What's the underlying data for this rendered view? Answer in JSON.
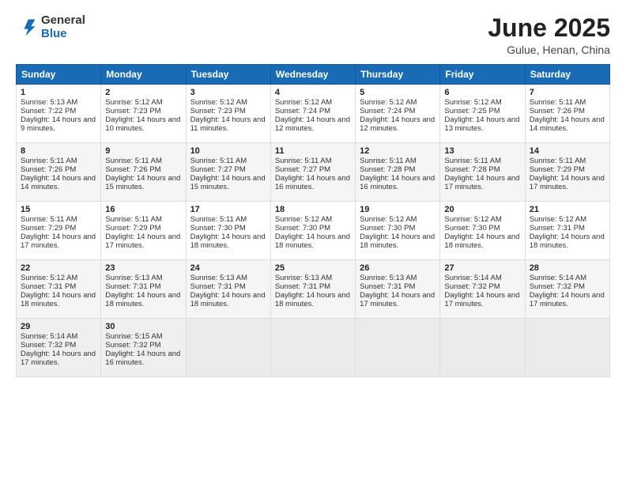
{
  "header": {
    "logo_line1": "General",
    "logo_line2": "Blue",
    "title": "June 2025",
    "subtitle": "Gulue, Henan, China"
  },
  "days_of_week": [
    "Sunday",
    "Monday",
    "Tuesday",
    "Wednesday",
    "Thursday",
    "Friday",
    "Saturday"
  ],
  "weeks": [
    [
      {
        "day": "1",
        "rise": "Sunrise: 5:13 AM",
        "set": "Sunset: 7:22 PM",
        "daylight": "Daylight: 14 hours and 9 minutes."
      },
      {
        "day": "2",
        "rise": "Sunrise: 5:12 AM",
        "set": "Sunset: 7:23 PM",
        "daylight": "Daylight: 14 hours and 10 minutes."
      },
      {
        "day": "3",
        "rise": "Sunrise: 5:12 AM",
        "set": "Sunset: 7:23 PM",
        "daylight": "Daylight: 14 hours and 11 minutes."
      },
      {
        "day": "4",
        "rise": "Sunrise: 5:12 AM",
        "set": "Sunset: 7:24 PM",
        "daylight": "Daylight: 14 hours and 12 minutes."
      },
      {
        "day": "5",
        "rise": "Sunrise: 5:12 AM",
        "set": "Sunset: 7:24 PM",
        "daylight": "Daylight: 14 hours and 12 minutes."
      },
      {
        "day": "6",
        "rise": "Sunrise: 5:12 AM",
        "set": "Sunset: 7:25 PM",
        "daylight": "Daylight: 14 hours and 13 minutes."
      },
      {
        "day": "7",
        "rise": "Sunrise: 5:11 AM",
        "set": "Sunset: 7:26 PM",
        "daylight": "Daylight: 14 hours and 14 minutes."
      }
    ],
    [
      {
        "day": "8",
        "rise": "Sunrise: 5:11 AM",
        "set": "Sunset: 7:26 PM",
        "daylight": "Daylight: 14 hours and 14 minutes."
      },
      {
        "day": "9",
        "rise": "Sunrise: 5:11 AM",
        "set": "Sunset: 7:26 PM",
        "daylight": "Daylight: 14 hours and 15 minutes."
      },
      {
        "day": "10",
        "rise": "Sunrise: 5:11 AM",
        "set": "Sunset: 7:27 PM",
        "daylight": "Daylight: 14 hours and 15 minutes."
      },
      {
        "day": "11",
        "rise": "Sunrise: 5:11 AM",
        "set": "Sunset: 7:27 PM",
        "daylight": "Daylight: 14 hours and 16 minutes."
      },
      {
        "day": "12",
        "rise": "Sunrise: 5:11 AM",
        "set": "Sunset: 7:28 PM",
        "daylight": "Daylight: 14 hours and 16 minutes."
      },
      {
        "day": "13",
        "rise": "Sunrise: 5:11 AM",
        "set": "Sunset: 7:28 PM",
        "daylight": "Daylight: 14 hours and 17 minutes."
      },
      {
        "day": "14",
        "rise": "Sunrise: 5:11 AM",
        "set": "Sunset: 7:29 PM",
        "daylight": "Daylight: 14 hours and 17 minutes."
      }
    ],
    [
      {
        "day": "15",
        "rise": "Sunrise: 5:11 AM",
        "set": "Sunset: 7:29 PM",
        "daylight": "Daylight: 14 hours and 17 minutes."
      },
      {
        "day": "16",
        "rise": "Sunrise: 5:11 AM",
        "set": "Sunset: 7:29 PM",
        "daylight": "Daylight: 14 hours and 17 minutes."
      },
      {
        "day": "17",
        "rise": "Sunrise: 5:11 AM",
        "set": "Sunset: 7:30 PM",
        "daylight": "Daylight: 14 hours and 18 minutes."
      },
      {
        "day": "18",
        "rise": "Sunrise: 5:12 AM",
        "set": "Sunset: 7:30 PM",
        "daylight": "Daylight: 14 hours and 18 minutes."
      },
      {
        "day": "19",
        "rise": "Sunrise: 5:12 AM",
        "set": "Sunset: 7:30 PM",
        "daylight": "Daylight: 14 hours and 18 minutes."
      },
      {
        "day": "20",
        "rise": "Sunrise: 5:12 AM",
        "set": "Sunset: 7:30 PM",
        "daylight": "Daylight: 14 hours and 18 minutes."
      },
      {
        "day": "21",
        "rise": "Sunrise: 5:12 AM",
        "set": "Sunset: 7:31 PM",
        "daylight": "Daylight: 14 hours and 18 minutes."
      }
    ],
    [
      {
        "day": "22",
        "rise": "Sunrise: 5:12 AM",
        "set": "Sunset: 7:31 PM",
        "daylight": "Daylight: 14 hours and 18 minutes."
      },
      {
        "day": "23",
        "rise": "Sunrise: 5:13 AM",
        "set": "Sunset: 7:31 PM",
        "daylight": "Daylight: 14 hours and 18 minutes."
      },
      {
        "day": "24",
        "rise": "Sunrise: 5:13 AM",
        "set": "Sunset: 7:31 PM",
        "daylight": "Daylight: 14 hours and 18 minutes."
      },
      {
        "day": "25",
        "rise": "Sunrise: 5:13 AM",
        "set": "Sunset: 7:31 PM",
        "daylight": "Daylight: 14 hours and 18 minutes."
      },
      {
        "day": "26",
        "rise": "Sunrise: 5:13 AM",
        "set": "Sunset: 7:31 PM",
        "daylight": "Daylight: 14 hours and 17 minutes."
      },
      {
        "day": "27",
        "rise": "Sunrise: 5:14 AM",
        "set": "Sunset: 7:32 PM",
        "daylight": "Daylight: 14 hours and 17 minutes."
      },
      {
        "day": "28",
        "rise": "Sunrise: 5:14 AM",
        "set": "Sunset: 7:32 PM",
        "daylight": "Daylight: 14 hours and 17 minutes."
      }
    ],
    [
      {
        "day": "29",
        "rise": "Sunrise: 5:14 AM",
        "set": "Sunset: 7:32 PM",
        "daylight": "Daylight: 14 hours and 17 minutes."
      },
      {
        "day": "30",
        "rise": "Sunrise: 5:15 AM",
        "set": "Sunset: 7:32 PM",
        "daylight": "Daylight: 14 hours and 16 minutes."
      },
      null,
      null,
      null,
      null,
      null
    ]
  ]
}
